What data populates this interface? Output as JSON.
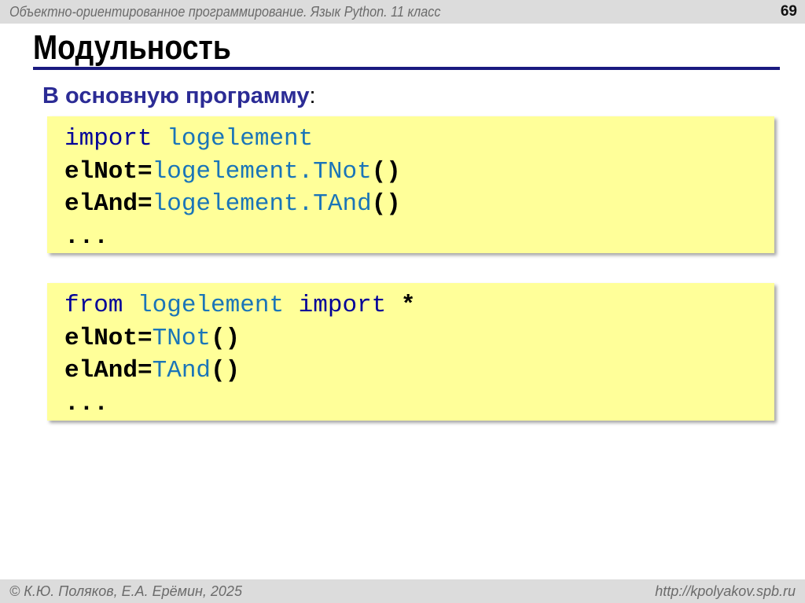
{
  "header": {
    "course": "Объектно-ориентированное программирование. Язык Python. 11 класс",
    "slide_number": "69"
  },
  "title": "Модульность",
  "subtitle": {
    "text": "В основную программу",
    "colon": ":"
  },
  "code_blocks": [
    {
      "lines": [
        [
          {
            "t": "import",
            "c": "kw"
          },
          {
            "t": " ",
            "c": "pl"
          },
          {
            "t": "logelement",
            "c": "id"
          }
        ],
        [
          {
            "t": "elNot",
            "c": "pl"
          },
          {
            "t": "=",
            "c": "pl"
          },
          {
            "t": "logelement.TNot",
            "c": "id"
          },
          {
            "t": "()",
            "c": "pl"
          }
        ],
        [
          {
            "t": "elAnd",
            "c": "pl"
          },
          {
            "t": "=",
            "c": "pl"
          },
          {
            "t": "logelement.TAnd",
            "c": "id"
          },
          {
            "t": "()",
            "c": "pl"
          }
        ],
        [
          {
            "t": "...",
            "c": "pl"
          }
        ]
      ]
    },
    {
      "lines": [
        [
          {
            "t": "from",
            "c": "kw"
          },
          {
            "t": " ",
            "c": "pl"
          },
          {
            "t": "logelement",
            "c": "id"
          },
          {
            "t": " ",
            "c": "pl"
          },
          {
            "t": "import",
            "c": "kw"
          },
          {
            "t": " *",
            "c": "pl"
          }
        ],
        [
          {
            "t": "elNot",
            "c": "pl"
          },
          {
            "t": "=",
            "c": "pl"
          },
          {
            "t": "TNot",
            "c": "id"
          },
          {
            "t": "()",
            "c": "pl"
          }
        ],
        [
          {
            "t": "elAnd",
            "c": "pl"
          },
          {
            "t": "=",
            "c": "pl"
          },
          {
            "t": "TAnd",
            "c": "id"
          },
          {
            "t": "()",
            "c": "pl"
          }
        ],
        [
          {
            "t": "...",
            "c": "pl"
          }
        ]
      ]
    }
  ],
  "footer": {
    "copyright": "© К.Ю. Поляков, Е.А. Ерёмин, 2025",
    "url": "http://kpolyakov.spb.ru"
  }
}
